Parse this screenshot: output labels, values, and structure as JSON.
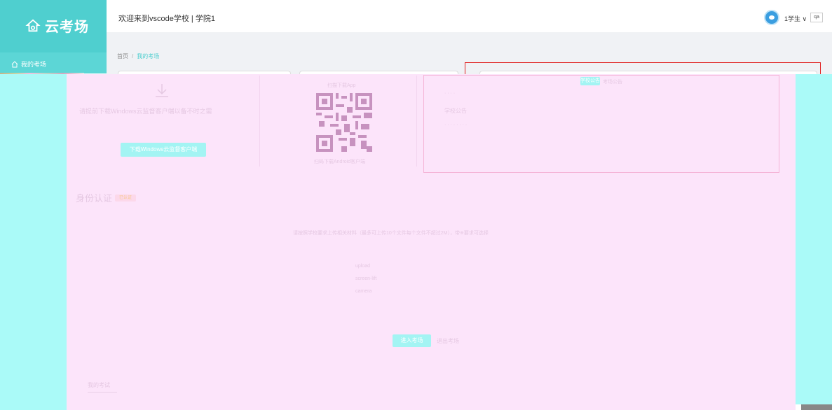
{
  "app": {
    "logo_text": "云考场"
  },
  "sidebar": {
    "items": [
      {
        "label": "我的考场",
        "icon": "home-icon"
      }
    ]
  },
  "header": {
    "welcome": "欢迎来到vscode学校 | 学院1",
    "user": "1学生 ∨",
    "lang": "qa"
  },
  "breadcrumb": {
    "home": "首页",
    "separator": "/",
    "current": "我的考场"
  },
  "download_card": {
    "tip": "请提前下载Windows云监督客户端以备不时之需",
    "button": "下载Windows云监督客户端"
  },
  "qr_card": {
    "title": "扫描下载App",
    "caption": "扫码下载Android客户端"
  },
  "notice": {
    "tabs": [
      "学校公告",
      "考场公告"
    ],
    "lines": [
      "· · · ·",
      "学校公告",
      "· · · · · · · ·"
    ]
  },
  "identity": {
    "title": "身份认证",
    "badge": "已认证",
    "instruction": "请按照学校要求上传相关材料（最多可上传10个文件每个文件不超过2M），带※要求可选择",
    "uploads": [
      "upload",
      "screen-lift",
      "camera"
    ]
  },
  "actions": {
    "start_button": "进入考场",
    "secondary": "退出考场"
  },
  "bottom_tab": "我的考试",
  "colors": {
    "brand": "#4fcfcf",
    "overlay_pink": "#fce4fa",
    "cyan": "#aafaf8",
    "notice_border": "#f5b3d6",
    "red_border": "#e02020"
  }
}
